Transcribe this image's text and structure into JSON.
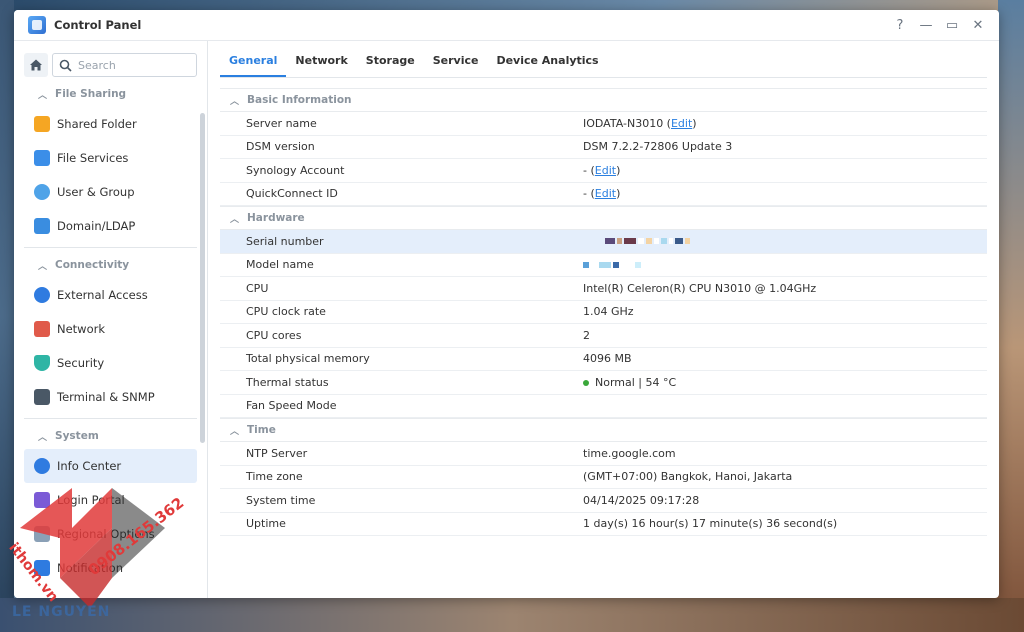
{
  "window": {
    "title": "Control Panel"
  },
  "window_controls": {
    "help": "?",
    "minimize": "—",
    "maximize": "▭",
    "close": "✕"
  },
  "search": {
    "placeholder": "Search"
  },
  "sidebar": {
    "sections": [
      {
        "label": "File Sharing",
        "items": [
          "Shared Folder",
          "File Services",
          "User & Group",
          "Domain/LDAP"
        ]
      },
      {
        "label": "Connectivity",
        "items": [
          "External Access",
          "Network",
          "Security",
          "Terminal & SNMP"
        ]
      },
      {
        "label": "System",
        "items": [
          "Info Center",
          "Login Portal",
          "Regional Options",
          "Notification"
        ]
      }
    ],
    "active_item": "Info Center"
  },
  "tabs": [
    "General",
    "Network",
    "Storage",
    "Service",
    "Device Analytics"
  ],
  "active_tab": "General",
  "basic": {
    "title": "Basic Information",
    "server_name_label": "Server name",
    "server_name_value": "IODATA-N3010 (",
    "server_name_link": "Edit",
    "dsm_label": "DSM version",
    "dsm_value": "DSM 7.2.2-72806 Update 3",
    "account_label": "Synology Account",
    "account_prefix": "- (",
    "account_link": "Edit",
    "qc_label": "QuickConnect ID",
    "qc_prefix": "- (",
    "qc_link": "Edit"
  },
  "hardware": {
    "title": "Hardware",
    "serial_label": "Serial number",
    "model_label": "Model name",
    "cpu_label": "CPU",
    "cpu_value": "Intel(R) Celeron(R) CPU N3010 @ 1.04GHz",
    "clock_label": "CPU clock rate",
    "clock_value": "1.04 GHz",
    "cores_label": "CPU cores",
    "cores_value": "2",
    "mem_label": "Total physical memory",
    "mem_value": "4096 MB",
    "thermal_label": "Thermal status",
    "thermal_value": "Normal | 54 °C",
    "fan_label": "Fan Speed Mode",
    "fan_value": ""
  },
  "time": {
    "title": "Time",
    "ntp_label": "NTP Server",
    "ntp_value": "time.google.com",
    "tz_label": "Time zone",
    "tz_value": "(GMT+07:00) Bangkok, Hanoi, Jakarta",
    "sys_label": "System time",
    "sys_value": "04/14/2025 09:17:28",
    "up_label": "Uptime",
    "up_value": "1 day(s) 16 hour(s) 17 minute(s) 36 second(s)"
  },
  "watermark": {
    "phone": "0908.165.362",
    "site": "ithom.vn",
    "brand": "LE NGUYEN"
  },
  "colors": {
    "accent": "#2a7fe0",
    "status_ok": "#3aa83a",
    "active_bg": "#e4eefb"
  }
}
